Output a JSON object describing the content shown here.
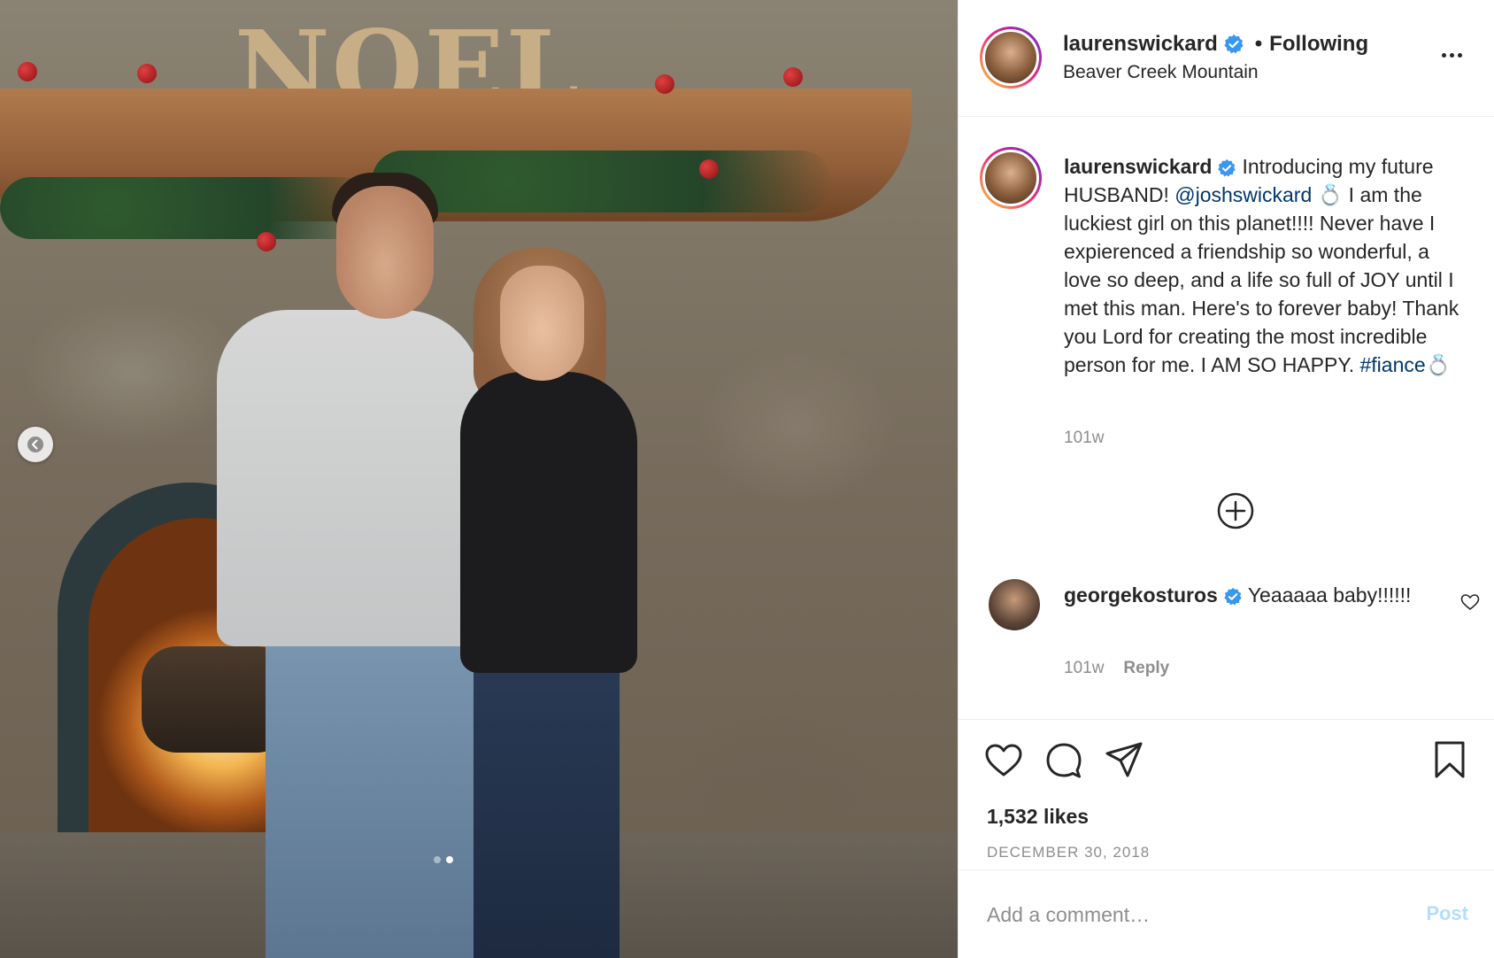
{
  "photo": {
    "sign_text": "NOEL",
    "carousel": {
      "total": 2,
      "active_index": 1
    }
  },
  "header": {
    "username": "laurenswickard",
    "separator": "•",
    "follow_status": "Following",
    "location": "Beaver Creek Mountain"
  },
  "caption": {
    "username": "laurenswickard",
    "text_part1": "Introducing my future HUSBAND! ",
    "mention": "@joshswickard",
    "ring_emoji": "💍",
    "text_part2": " I am the luckiest girl on this planet!!!! Never have I expierenced a friendship so wonderful, a love so deep, and a life so full of JOY until I met this man. Here's to forever baby! Thank you Lord for creating the most incredible person for me. I AM SO HAPPY. ",
    "hashtag": "#fiance",
    "ring_emoji_end": "💍",
    "time": "101w"
  },
  "comment": {
    "username": "georgekosturos",
    "text": "Yeaaaaa baby!!!!!!",
    "time": "101w",
    "reply_label": "Reply"
  },
  "actions": {
    "likes": "1,532 likes",
    "date": "DECEMBER 30, 2018"
  },
  "comment_box": {
    "placeholder": "Add a comment…",
    "post_label": "Post"
  },
  "colors": {
    "verified": "#3897f0",
    "link": "#00376b",
    "post_disabled": "#b2dffc",
    "muted": "#8e8e8e"
  }
}
